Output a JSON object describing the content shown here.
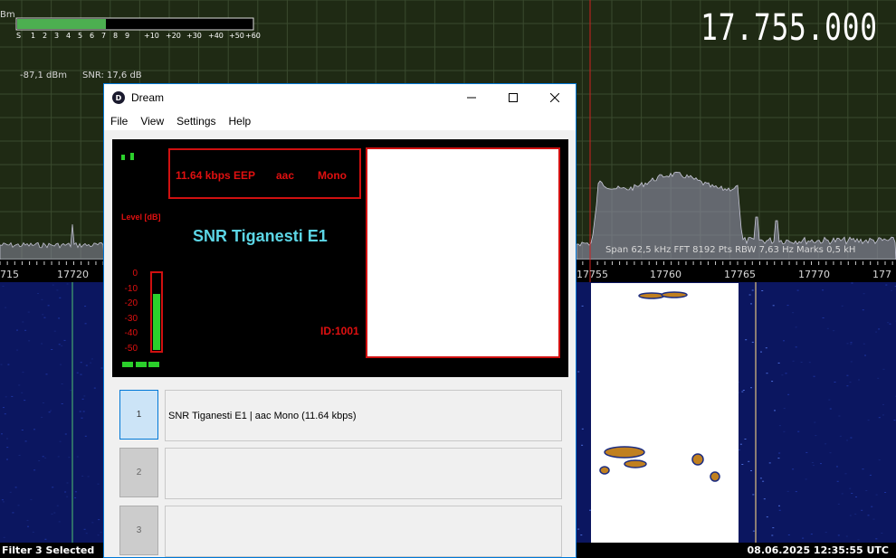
{
  "sdr": {
    "level_unit_fragment": "Bm",
    "smeter_scale": [
      "S",
      "1",
      "2",
      "3",
      "4",
      "5",
      "6",
      "7",
      "8",
      "9",
      "+10",
      "+20",
      "+30",
      "+40",
      "+50",
      "+60"
    ],
    "signal_level": "-87,1 dBm",
    "snr_readout": "SNR: 17,6 dB",
    "frequency_display": "17.755.000",
    "spectrum_info": "Span 62,5 kHz   FFT 8192 Pts   RBW 7,63 Hz   Marks 0,5 kH",
    "axis_ticks": [
      "715",
      "17720",
      "17755",
      "17760",
      "17765",
      "17770",
      "177"
    ],
    "status_left": "Filter 3 Selected",
    "status_right": "08.06.2025 12:35:55 UTC",
    "colors": {
      "background": "#1f2a14",
      "spectrum_fill": "#7a7a8c",
      "waterfall": "#0a1560",
      "marker": "#d02020",
      "smeter": "#4caf50"
    }
  },
  "dream": {
    "title": "Dream",
    "icon": "dream-app-icon",
    "icon_letter": "D",
    "menu": [
      "File",
      "View",
      "Settings",
      "Help"
    ],
    "bitrate_info": "11.64 kbps EEP",
    "codec": "aac",
    "channels": "Mono",
    "level_label": "Level [dB]",
    "level_ticks": [
      "0",
      "-10",
      "-20",
      "-30",
      "-40",
      "-50"
    ],
    "station_name": "SNR Tiganesti E1",
    "service_id": "ID:1001",
    "signal_level_fraction": 0.84,
    "services": [
      {
        "number": "1",
        "label": "SNR Tiganesti E1  |  aac Mono (11.64 kbps)",
        "selected": true
      },
      {
        "number": "2",
        "label": "",
        "selected": false
      },
      {
        "number": "3",
        "label": "",
        "selected": false
      }
    ]
  }
}
